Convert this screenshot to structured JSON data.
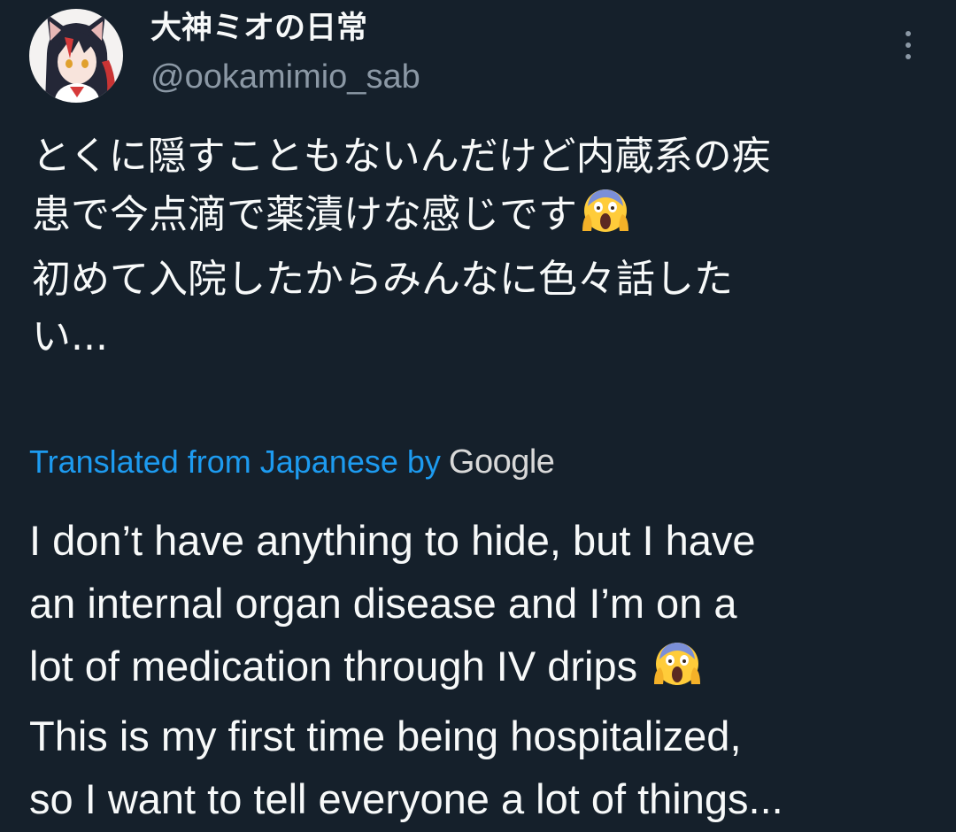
{
  "author": {
    "display_name": "大神ミオの日常",
    "handle": "@ookamimio_sab",
    "avatar_icon": "avatar-wolf-girl"
  },
  "menu": {
    "icon": "more-vertical-icon"
  },
  "tweet": {
    "original_lines": [
      "とくに隠すこともないんだけど内蔵系の疾",
      "患で今点滴で薬漬けな感じです",
      "初めて入院したからみんなに色々話した",
      "い..."
    ],
    "translation_label": "Translated from Japanese by",
    "translation_provider": "Google",
    "translated_lines": [
      "I don’t have anything to hide, but I have",
      "an internal organ disease and I’m on a",
      "lot of medication through IV drips",
      "This is my first time being hospitalized,",
      "so I want to tell everyone a lot of things..."
    ],
    "emoji": "screaming-face-emoji"
  },
  "colors": {
    "background": "#15202b",
    "text": "#f7f9f9",
    "secondary": "#8b98a5",
    "link": "#1d9bf0"
  }
}
